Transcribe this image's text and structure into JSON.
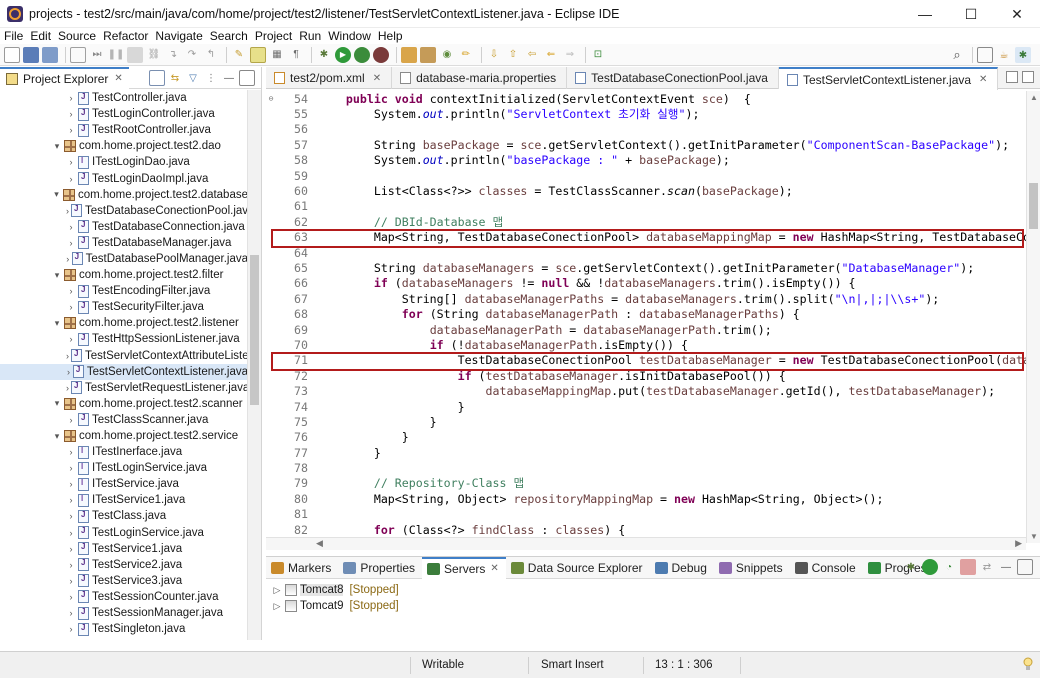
{
  "window": {
    "title": "projects - test2/src/main/java/com/home/project/test2/listener/TestServletContextListener.java - Eclipse IDE",
    "controls": {
      "minimize": "—",
      "maximize": "☐",
      "close": "✕"
    }
  },
  "menu": [
    "File",
    "Edit",
    "Source",
    "Refactor",
    "Navigate",
    "Search",
    "Project",
    "Run",
    "Window",
    "Help"
  ],
  "project_explorer": {
    "title": "Project Explorer",
    "items": [
      {
        "type": "class",
        "label": "TestController.java",
        "indent": 3
      },
      {
        "type": "class",
        "label": "TestLoginController.java",
        "indent": 3
      },
      {
        "type": "class",
        "label": "TestRootController.java",
        "indent": 3
      },
      {
        "type": "package",
        "label": "com.home.project.test2.dao",
        "indent": 2,
        "expanded": true
      },
      {
        "type": "interface",
        "label": "ITestLoginDao.java",
        "indent": 3
      },
      {
        "type": "class",
        "label": "TestLoginDaoImpl.java",
        "indent": 3
      },
      {
        "type": "package",
        "label": "com.home.project.test2.database",
        "indent": 2,
        "expanded": true
      },
      {
        "type": "class",
        "label": "TestDatabaseConectionPool.java",
        "indent": 3
      },
      {
        "type": "class",
        "label": "TestDatabaseConnection.java",
        "indent": 3
      },
      {
        "type": "class",
        "label": "TestDatabaseManager.java",
        "indent": 3
      },
      {
        "type": "class",
        "label": "TestDatabasePoolManager.java",
        "indent": 3
      },
      {
        "type": "package",
        "label": "com.home.project.test2.filter",
        "indent": 2,
        "expanded": true
      },
      {
        "type": "class",
        "label": "TestEncodingFilter.java",
        "indent": 3
      },
      {
        "type": "class",
        "label": "TestSecurityFilter.java",
        "indent": 3
      },
      {
        "type": "package",
        "label": "com.home.project.test2.listener",
        "indent": 2,
        "expanded": true
      },
      {
        "type": "class",
        "label": "TestHttpSessionListener.java",
        "indent": 3
      },
      {
        "type": "class",
        "label": "TestServletContextAttributeListe",
        "indent": 3
      },
      {
        "type": "class",
        "label": "TestServletContextListener.java",
        "indent": 3,
        "selected": true
      },
      {
        "type": "class",
        "label": "TestServletRequestListener.java",
        "indent": 3
      },
      {
        "type": "package",
        "label": "com.home.project.test2.scanner",
        "indent": 2,
        "expanded": true
      },
      {
        "type": "class",
        "label": "TestClassScanner.java",
        "indent": 3
      },
      {
        "type": "package",
        "label": "com.home.project.test2.service",
        "indent": 2,
        "expanded": true
      },
      {
        "type": "interface",
        "label": "ITestInerface.java",
        "indent": 3
      },
      {
        "type": "interface",
        "label": "ITestLoginService.java",
        "indent": 3
      },
      {
        "type": "interface",
        "label": "ITestService.java",
        "indent": 3
      },
      {
        "type": "interface",
        "label": "ITestService1.java",
        "indent": 3
      },
      {
        "type": "class",
        "label": "TestClass.java",
        "indent": 3
      },
      {
        "type": "class",
        "label": "TestLoginService.java",
        "indent": 3
      },
      {
        "type": "class",
        "label": "TestService1.java",
        "indent": 3
      },
      {
        "type": "class",
        "label": "TestService2.java",
        "indent": 3
      },
      {
        "type": "class",
        "label": "TestService3.java",
        "indent": 3
      },
      {
        "type": "class",
        "label": "TestSessionCounter.java",
        "indent": 3
      },
      {
        "type": "class",
        "label": "TestSessionManager.java",
        "indent": 3
      },
      {
        "type": "class",
        "label": "TestSingleton.java",
        "indent": 3
      }
    ]
  },
  "editor_tabs": [
    {
      "label": "test2/pom.xml",
      "active": false
    },
    {
      "label": "database-maria.properties",
      "active": false
    },
    {
      "label": "TestDatabaseConectionPool.java",
      "active": false
    },
    {
      "label": "TestServletContextListener.java",
      "active": true
    }
  ],
  "code_lines": [
    {
      "n": "54",
      "marker": "⊖",
      "html": "    <span class=\"kw\">public</span> <span class=\"kw\">void</span> contextInitialized(ServletContextEvent <span class=\"var\">sce</span>)  {"
    },
    {
      "n": "55",
      "html": "        System.<span class=\"fld\">out</span>.println(<span class=\"str\">\"ServletContext 초기화 실행\"</span>);"
    },
    {
      "n": "56",
      "html": ""
    },
    {
      "n": "57",
      "html": "        String <span class=\"var\">basePackage</span> = <span class=\"var\">sce</span>.getServletContext().getInitParameter(<span class=\"str\">\"ComponentScan-BasePackage\"</span>);"
    },
    {
      "n": "58",
      "html": "        System.<span class=\"fld\">out</span>.println(<span class=\"str\">\"basePackage : \"</span> + <span class=\"var\">basePackage</span>);"
    },
    {
      "n": "59",
      "html": ""
    },
    {
      "n": "60",
      "html": "        List&lt;Class&lt;?&gt;&gt; <span class=\"var\">classes</span> = TestClassScanner.<span class=\"it\">scan</span>(<span class=\"var\">basePackage</span>);"
    },
    {
      "n": "61",
      "html": ""
    },
    {
      "n": "62",
      "html": "        <span class=\"cm\">// DBId-Database 맵</span>"
    },
    {
      "n": "63",
      "highlight": true,
      "html": "        Map&lt;String, TestDatabaseConectionPool&gt; <span class=\"var\">databaseMappingMap</span> = <span class=\"kw\">new</span> HashMap&lt;String, TestDatabaseConectionPool&gt;();"
    },
    {
      "n": "64",
      "html": ""
    },
    {
      "n": "65",
      "html": "        String <span class=\"var\">databaseManagers</span> = <span class=\"var\">sce</span>.getServletContext().getInitParameter(<span class=\"str\">\"DatabaseManager\"</span>);"
    },
    {
      "n": "66",
      "html": "        <span class=\"kw\">if</span> (<span class=\"var\">databaseManagers</span> != <span class=\"kw\">null</span> &amp;&amp; !<span class=\"var\">databaseManagers</span>.trim().isEmpty()) {"
    },
    {
      "n": "67",
      "html": "            String[] <span class=\"var\">databaseManagerPaths</span> = <span class=\"var\">databaseManagers</span>.trim().split(<span class=\"str\">\"\\n|,|;|\\\\s+\"</span>);"
    },
    {
      "n": "68",
      "html": "            <span class=\"kw\">for</span> (String <span class=\"var\">databaseManagerPath</span> : <span class=\"var\">databaseManagerPaths</span>) {"
    },
    {
      "n": "69",
      "html": "                <span class=\"var\">databaseManagerPath</span> = <span class=\"var\">databaseManagerPath</span>.trim();"
    },
    {
      "n": "70",
      "html": "                <span class=\"kw\">if</span> (!<span class=\"var\">databaseManagerPath</span>.isEmpty()) {"
    },
    {
      "n": "71",
      "highlight": true,
      "html": "                    TestDatabaseConectionPool <span class=\"var\">testDatabaseManager</span> = <span class=\"kw\">new</span> TestDatabaseConectionPool(<span class=\"var\">databaseManagerPath</span>);"
    },
    {
      "n": "72",
      "html": "                    <span class=\"kw\">if</span> (<span class=\"var\">testDatabaseManager</span>.isInitDatabasePool()) {"
    },
    {
      "n": "73",
      "html": "                        <span class=\"var\">databaseMappingMap</span>.put(<span class=\"var\">testDatabaseManager</span>.getId(), <span class=\"var\">testDatabaseManager</span>);"
    },
    {
      "n": "74",
      "html": "                    }"
    },
    {
      "n": "75",
      "html": "                }"
    },
    {
      "n": "76",
      "html": "            }"
    },
    {
      "n": "77",
      "html": "        }"
    },
    {
      "n": "78",
      "html": ""
    },
    {
      "n": "79",
      "html": "        <span class=\"cm\">// Repository-Class 맵</span>"
    },
    {
      "n": "80",
      "html": "        Map&lt;String, Object&gt; <span class=\"var\">repositoryMappingMap</span> = <span class=\"kw\">new</span> HashMap&lt;String, Object&gt;();"
    },
    {
      "n": "81",
      "html": ""
    },
    {
      "n": "82",
      "html": "        <span class=\"kw\">for</span> (Class&lt;?&gt; <span class=\"var\">findClass</span> : <span class=\"var\">classes</span>) {"
    }
  ],
  "bottom_tabs": [
    {
      "label": "Markers",
      "color": "#c98a2b"
    },
    {
      "label": "Properties",
      "color": "#6f8db5"
    },
    {
      "label": "Servers",
      "color": "#3b7d3b",
      "active": true
    },
    {
      "label": "Data Source Explorer",
      "color": "#6b8a3a"
    },
    {
      "label": "Debug",
      "color": "#4d7bb0"
    },
    {
      "label": "Snippets",
      "color": "#8f6bb0"
    },
    {
      "label": "Console",
      "color": "#555555"
    },
    {
      "label": "Progress",
      "color": "#2f8f3f"
    }
  ],
  "servers": [
    {
      "name": "Tomcat8",
      "status": "[Stopped]",
      "selected": true
    },
    {
      "name": "Tomcat9",
      "status": "[Stopped]",
      "selected": false
    }
  ],
  "status_bar": {
    "mode": "Writable",
    "insert": "Smart Insert",
    "position": "13 : 1 : 306"
  }
}
